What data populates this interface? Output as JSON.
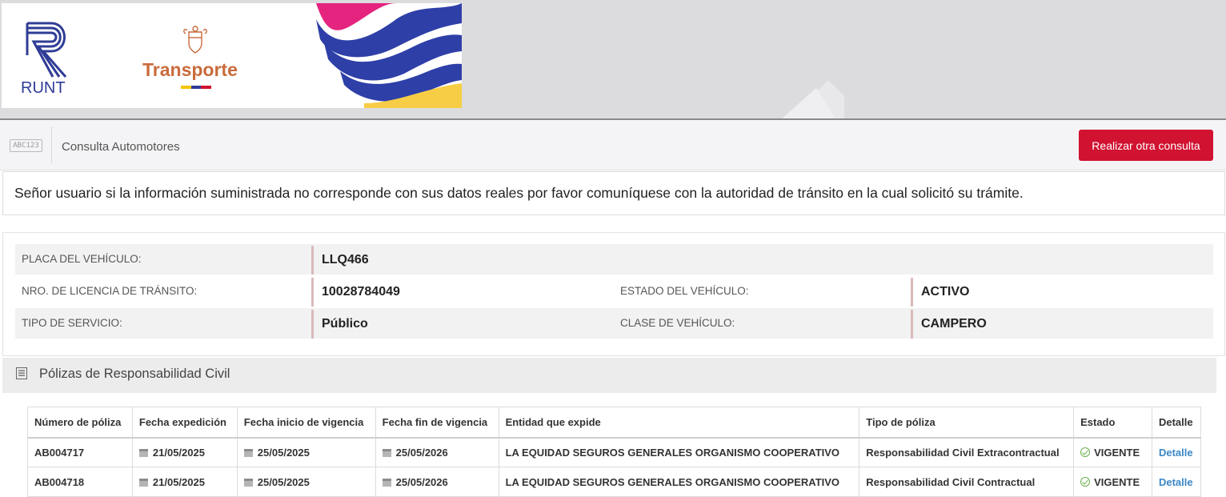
{
  "header": {
    "runt_logo_text": "RUNT",
    "ministry_text": "Transporte"
  },
  "consulta_bar": {
    "icon_text": "ABC123",
    "title": "Consulta Automotores",
    "button_label": "Realizar otra consulta"
  },
  "notice": {
    "text": "Señor usuario si la información suministrada no corresponde con sus datos reales por favor comuníquese con la autoridad de tránsito en la cual solicitó su trámite."
  },
  "vehicle": {
    "placa_label": "PLACA DEL VEHÍCULO:",
    "placa_value": "LLQ466",
    "licencia_label": "NRO. DE LICENCIA DE TRÁNSITO:",
    "licencia_value": "10028784049",
    "estado_label": "ESTADO DEL VEHÍCULO:",
    "estado_value": "ACTIVO",
    "servicio_label": "TIPO DE SERVICIO:",
    "servicio_value": "Público",
    "clase_label": "CLASE DE VEHÍCULO:",
    "clase_value": "CAMPERO"
  },
  "polizas": {
    "title": "Pólizas de Responsabilidad Civil",
    "columns": [
      "Número de póliza",
      "Fecha expedición",
      "Fecha inicio de vigencia",
      "Fecha fin de vigencia",
      "Entidad que expide",
      "Tipo de póliza",
      "Estado",
      "Detalle"
    ],
    "rows": [
      {
        "numero": "AB004717",
        "expedicion": "21/05/2025",
        "inicio": "25/05/2025",
        "fin": "25/05/2026",
        "entidad": "LA EQUIDAD SEGUROS GENERALES ORGANISMO COOPERATIVO",
        "tipo": "Responsabilidad Civil Extracontractual",
        "estado": "VIGENTE",
        "detalle": "Detalle"
      },
      {
        "numero": "AB004718",
        "expedicion": "21/05/2025",
        "inicio": "25/05/2025",
        "fin": "25/05/2026",
        "entidad": "LA EQUIDAD SEGUROS GENERALES ORGANISMO COOPERATIVO",
        "tipo": "Responsabilidad Civil Contractual",
        "estado": "VIGENTE",
        "detalle": "Detalle"
      }
    ]
  },
  "colors": {
    "accent_red": "#d11231",
    "runt_blue": "#2f3c96",
    "transporte_orange": "#c96b3c",
    "link_blue": "#3c87c7",
    "status_green": "#6ab04c"
  },
  "icons": {
    "runt": "runt-logo-icon",
    "coat_of_arms": "coat-of-arms-icon",
    "abc": "license-plate-icon",
    "list": "list-icon",
    "calendar": "calendar-icon",
    "check": "check-circle-icon"
  }
}
